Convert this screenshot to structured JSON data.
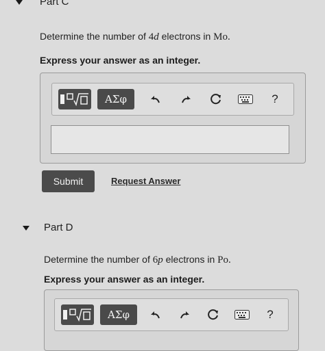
{
  "part_c": {
    "title": "Part C",
    "question_prefix": "Determine the number of",
    "orbital_number": "4",
    "orbital_letter": "d",
    "question_mid": "electrons in",
    "element": "Mo.",
    "instruction": "Express your answer as an integer.",
    "answer_value": "",
    "submit_label": "Submit",
    "request_label": "Request Answer"
  },
  "part_d": {
    "title": "Part D",
    "question_prefix": "Determine the number of",
    "orbital_number": "6",
    "orbital_letter": "p",
    "question_mid": "electrons in",
    "element": "Po.",
    "instruction": "Express your answer as an integer."
  },
  "toolbar": {
    "greek_label": "ΑΣφ",
    "help_label": "?"
  },
  "icons": [
    "templates-icon",
    "undo-icon",
    "redo-icon",
    "reset-icon",
    "keyboard-icon",
    "help-icon",
    "collapse-triangle-icon"
  ]
}
